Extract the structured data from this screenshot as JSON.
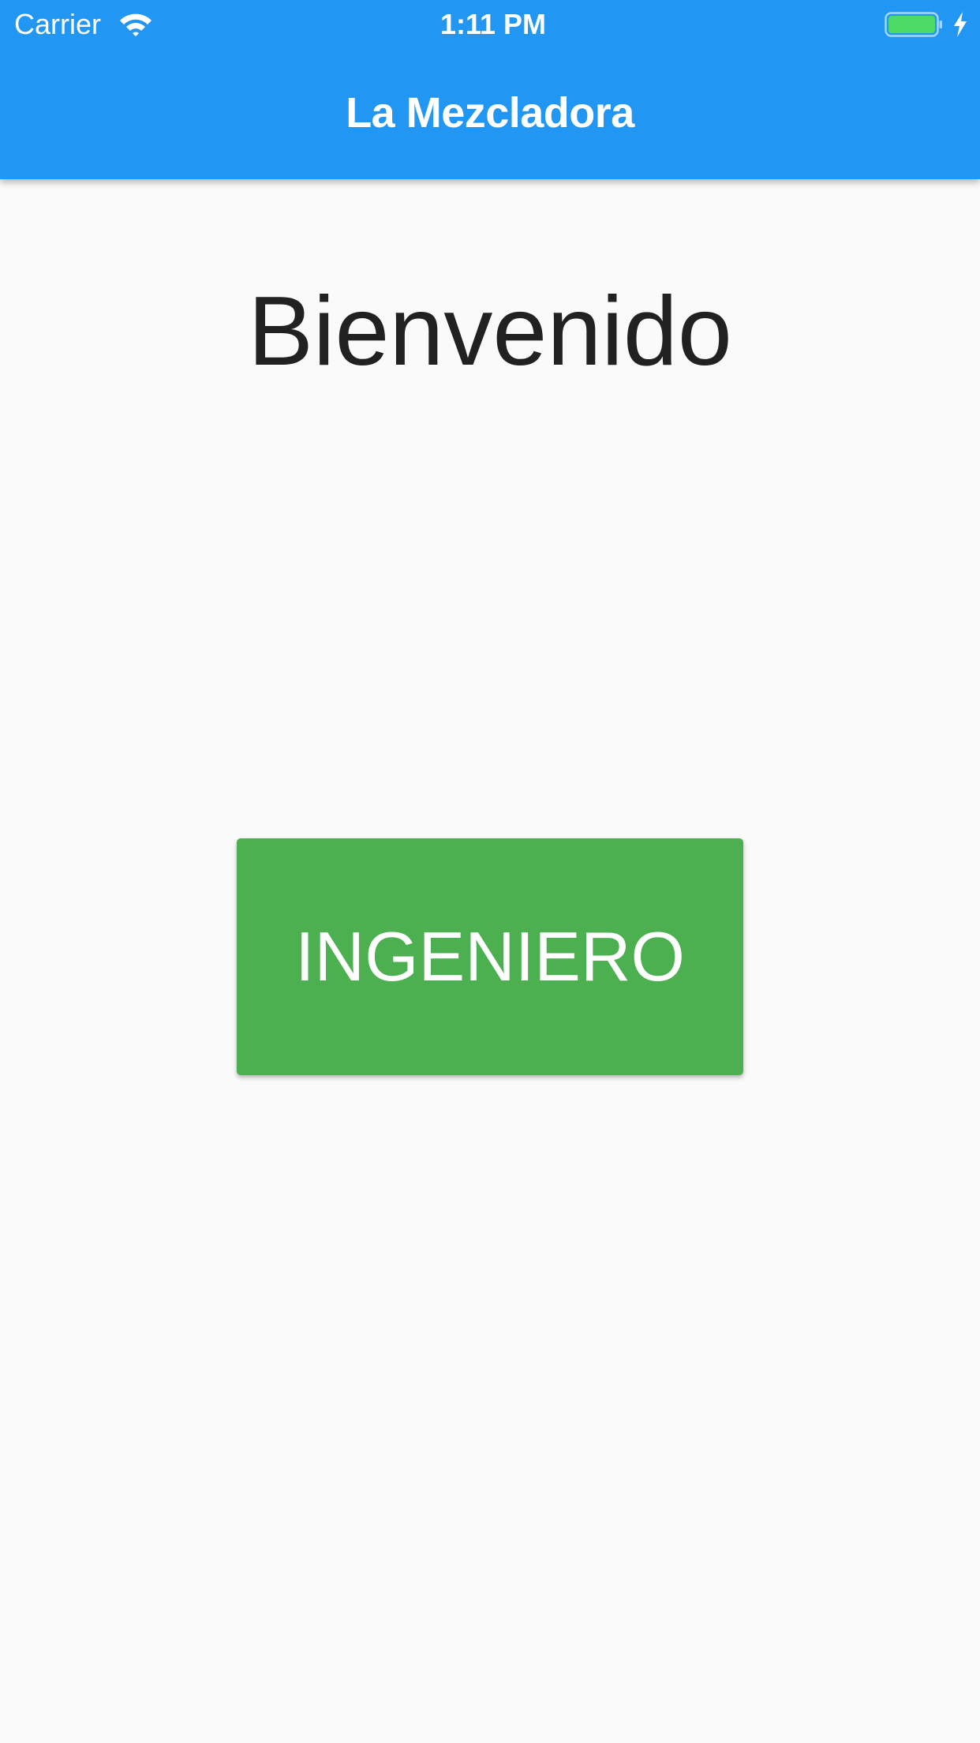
{
  "status_bar": {
    "carrier": "Carrier",
    "time": "1:11 PM",
    "wifi_icon": "wifi-icon",
    "battery_icon": "battery-icon",
    "charging_icon": "charging-bolt-icon",
    "battery_color": "#4cd964"
  },
  "app_bar": {
    "title": "La Mezcladora",
    "color": "#2196f3"
  },
  "main": {
    "welcome_text": "Bienvenido",
    "role_button_label": "INGENIERO",
    "role_button_color": "#4caf50"
  }
}
